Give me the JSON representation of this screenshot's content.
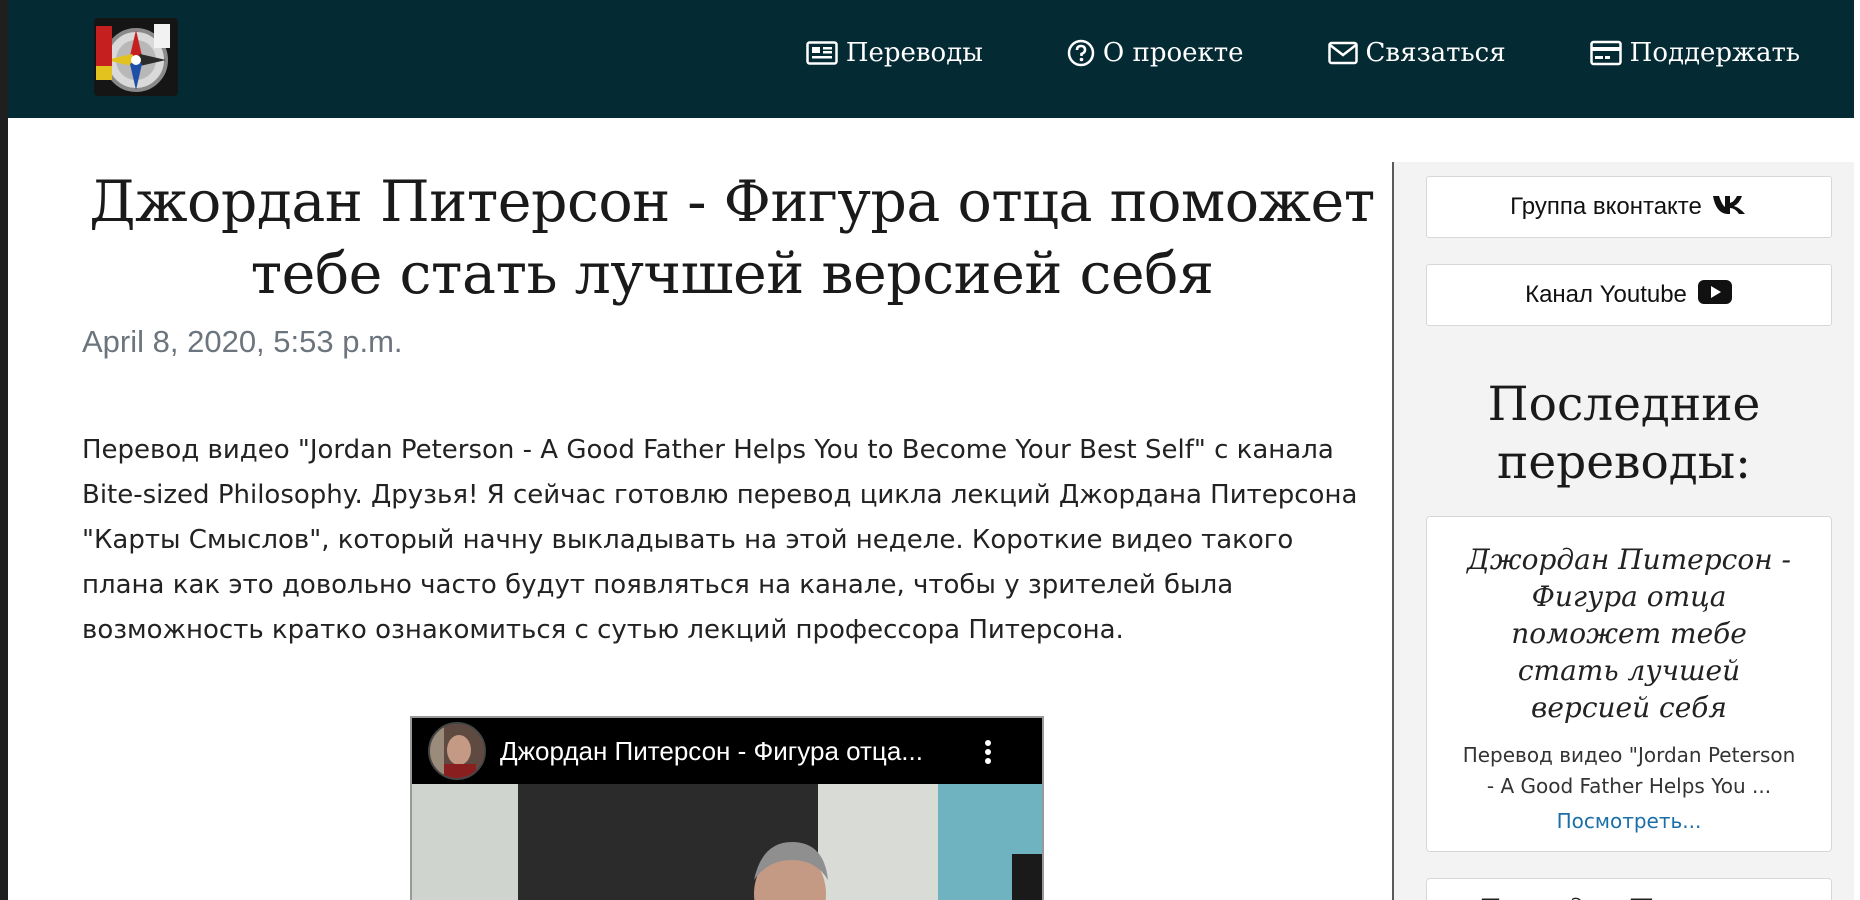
{
  "navbar": {
    "items": [
      {
        "label": "Переводы",
        "icon": "newspaper-icon"
      },
      {
        "label": "О проекте",
        "icon": "question-circle-icon"
      },
      {
        "label": "Связаться",
        "icon": "envelope-icon"
      },
      {
        "label": "Поддержать",
        "icon": "credit-card-icon"
      }
    ],
    "background": "#042a33"
  },
  "article": {
    "title": "Джордан Питерсон - Фигура отца поможет тебе стать лучшей версией себя",
    "date": "April 8, 2020, 5:53 p.m.",
    "body": "Перевод видео \"Jordan Peterson - A Good Father Helps You to Become Your Best Self\" с канала Bite-sized Philosophy. Друзья! Я сейчас готовлю перевод цикла лекций Джордана Питерсона \"Карты Смыслов\", который начну выкладывать на этой неделе. Короткие видео такого плана как это довольно часто будут появляться на канале, чтобы у зрителей была возможность кратко ознакомиться с сутью лекций профессора Питерсона.",
    "video": {
      "title": "Джордан Питерсон - Фигура отца..."
    }
  },
  "sidebar": {
    "vk_button": "Группа вконтакте",
    "youtube_button": "Канал Youtube",
    "heading": "Последние переводы:",
    "cards": [
      {
        "title": "Джордан Питерсон - Фигура отца поможет тебе стать лучшей версией себя",
        "excerpt": "Перевод видео \"Jordan Peterson - A Good Father Helps You ...",
        "link": "Посмотреть..."
      },
      {
        "title": "Джордан Питерсон"
      }
    ]
  }
}
